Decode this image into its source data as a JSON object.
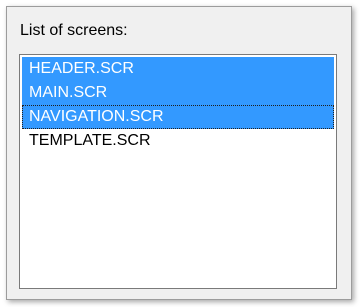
{
  "panel": {
    "label": "List of screens:"
  },
  "list": {
    "items": [
      {
        "label": "HEADER.SCR",
        "selected": true,
        "focused": false
      },
      {
        "label": "MAIN.SCR",
        "selected": true,
        "focused": false
      },
      {
        "label": "NAVIGATION.SCR",
        "selected": true,
        "focused": true
      },
      {
        "label": "TEMPLATE.SCR",
        "selected": false,
        "focused": false
      }
    ]
  },
  "colors": {
    "selection": "#3399ff",
    "selection_text": "#ffffff",
    "panel_background": "#f0f0f0"
  }
}
